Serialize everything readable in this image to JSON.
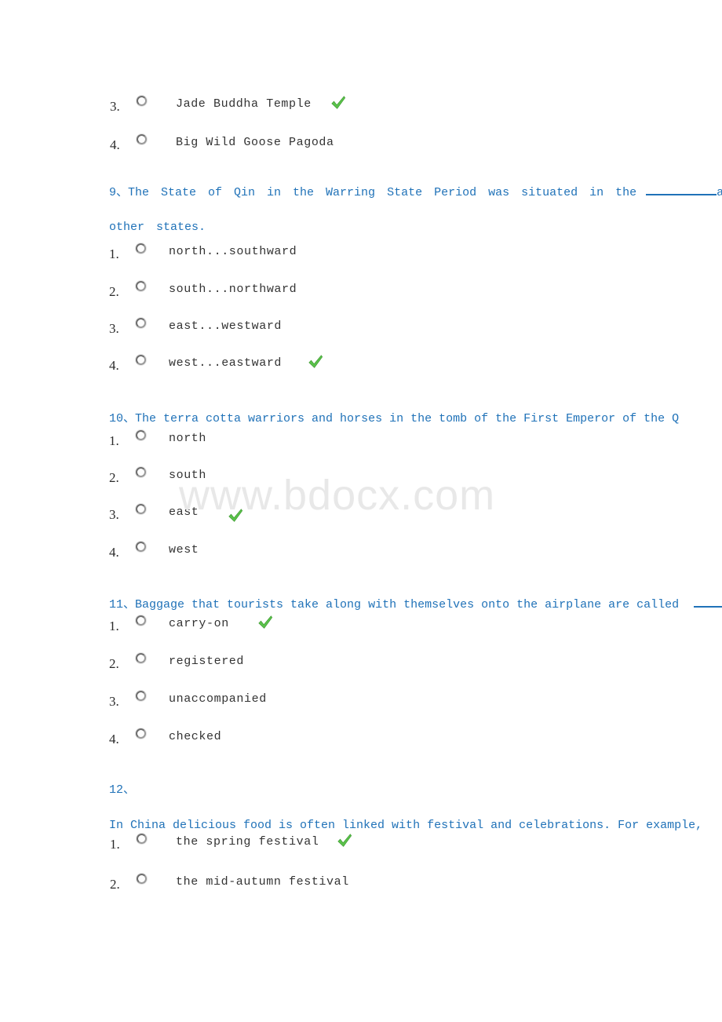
{
  "document": {
    "watermark": "www.bdocx.com",
    "colors": {
      "question_text": "#2072b8",
      "option_text": "#333333",
      "check_mark": "#5ac24a",
      "watermark": "#e8e8e8",
      "page_background": "#ffffff"
    }
  },
  "questions": [
    {
      "id": "q8-tail",
      "number": "",
      "stem": "",
      "stem_second_line": "",
      "options": [
        {
          "num": "3.",
          "label": "Jade Buddha Temple",
          "correct": true
        },
        {
          "num": "4.",
          "label": "Big Wild Goose Pagoda",
          "correct": false
        }
      ]
    },
    {
      "id": "q9",
      "number": "9、",
      "stem": "The  State  of  Qin  in  the  Warring  State  Period  was  situated  in  the",
      "stem_after_blank": "and",
      "stem_second_line": "other  states.",
      "options": [
        {
          "num": "1.",
          "label": "north...southward",
          "correct": false
        },
        {
          "num": "2.",
          "label": "south...northward",
          "correct": false
        },
        {
          "num": "3.",
          "label": "east...westward",
          "correct": false
        },
        {
          "num": "4.",
          "label": "west...eastward",
          "correct": true
        }
      ]
    },
    {
      "id": "q10",
      "number": "10、",
      "stem": "The terra  cotta warriors  and horses  in the tomb  of the First  Emperor of  the Q",
      "options": [
        {
          "num": "1.",
          "label": "north",
          "correct": false
        },
        {
          "num": "2.",
          "label": "south",
          "correct": false
        },
        {
          "num": "3.",
          "label": "east",
          "correct": true
        },
        {
          "num": "4.",
          "label": "west",
          "correct": false
        }
      ]
    },
    {
      "id": "q11",
      "number": "11、",
      "stem": "Baggage that  tourists  take along with  themselves  onto the airplane  are called",
      "options": [
        {
          "num": "1.",
          "label": "carry-on",
          "correct": true
        },
        {
          "num": "2.",
          "label": "registered",
          "correct": false
        },
        {
          "num": "3.",
          "label": "unaccompanied",
          "correct": false
        },
        {
          "num": "4.",
          "label": "checked",
          "correct": false
        }
      ]
    },
    {
      "id": "q12",
      "number": "12、",
      "stem": "",
      "stem_second_line": "In China delicious food is often linked with festival and celebrations. For  example,",
      "options": [
        {
          "num": "1.",
          "label": "the spring festival",
          "correct": true
        },
        {
          "num": "2.",
          "label": "the mid-autumn festival",
          "correct": false
        }
      ]
    }
  ]
}
